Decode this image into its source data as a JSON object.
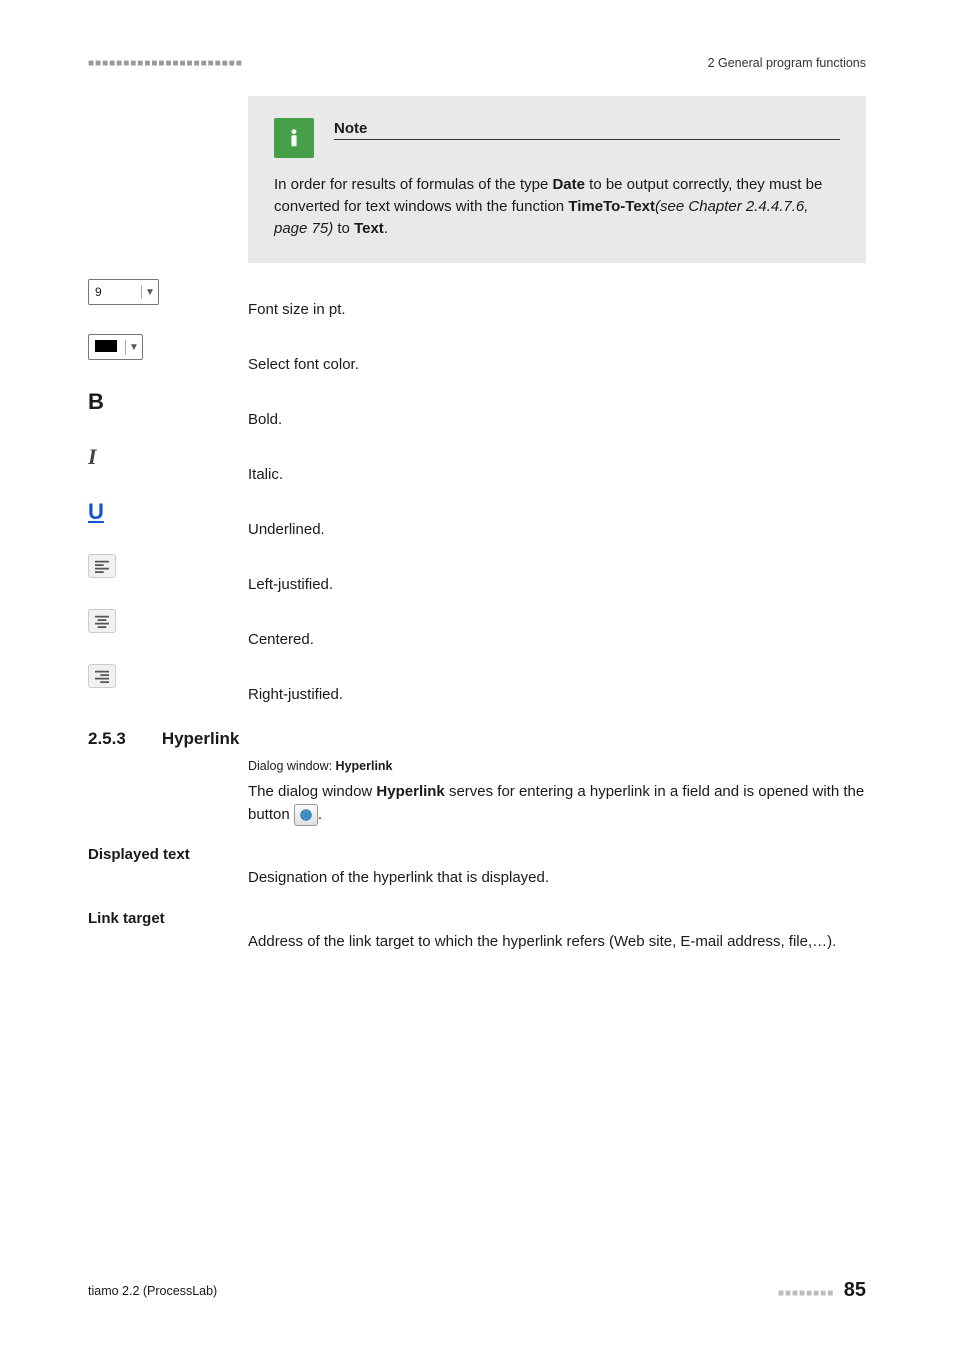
{
  "header": {
    "chapter": "2 General program functions"
  },
  "note": {
    "title": "Note",
    "text_pre": "In order for results of formulas of the type ",
    "text_date": "Date",
    "text_mid": " to be output correctly, they must be converted for text windows with the function ",
    "text_fn": "TimeTo-Text",
    "text_ref": "(see Chapter 2.4.4.7.6, page 75)",
    "text_to": " to ",
    "text_target": "Text",
    "text_end": "."
  },
  "options": {
    "font_size_value": "9",
    "font_size_desc": "Font size in pt.",
    "font_color_desc": "Select font color.",
    "bold_glyph": "B",
    "bold_desc": "Bold.",
    "italic_glyph": "I",
    "italic_desc": "Italic.",
    "underline_glyph": "U",
    "underline_desc": "Underlined.",
    "left_desc": "Left-justified.",
    "center_desc": "Centered.",
    "right_desc": "Right-justified."
  },
  "hyperlink": {
    "sec_num": "2.5.3",
    "sec_title": "Hyperlink",
    "dlg_label": "Dialog window: ",
    "dlg_name": "Hyperlink",
    "intro_pre": "The dialog window ",
    "intro_name": "Hyperlink",
    "intro_mid": " serves for entering a hyperlink in a field and is opened with the button ",
    "intro_end": ".",
    "displayed_text_term": "Displayed text",
    "displayed_text_desc": "Designation of the hyperlink that is displayed.",
    "link_target_term": "Link target",
    "link_target_desc": "Address of the link target to which the hyperlink refers (Web site, E-mail address, file,…)."
  },
  "footer": {
    "product": "tiamo 2.2 (ProcessLab)",
    "page": "85"
  }
}
